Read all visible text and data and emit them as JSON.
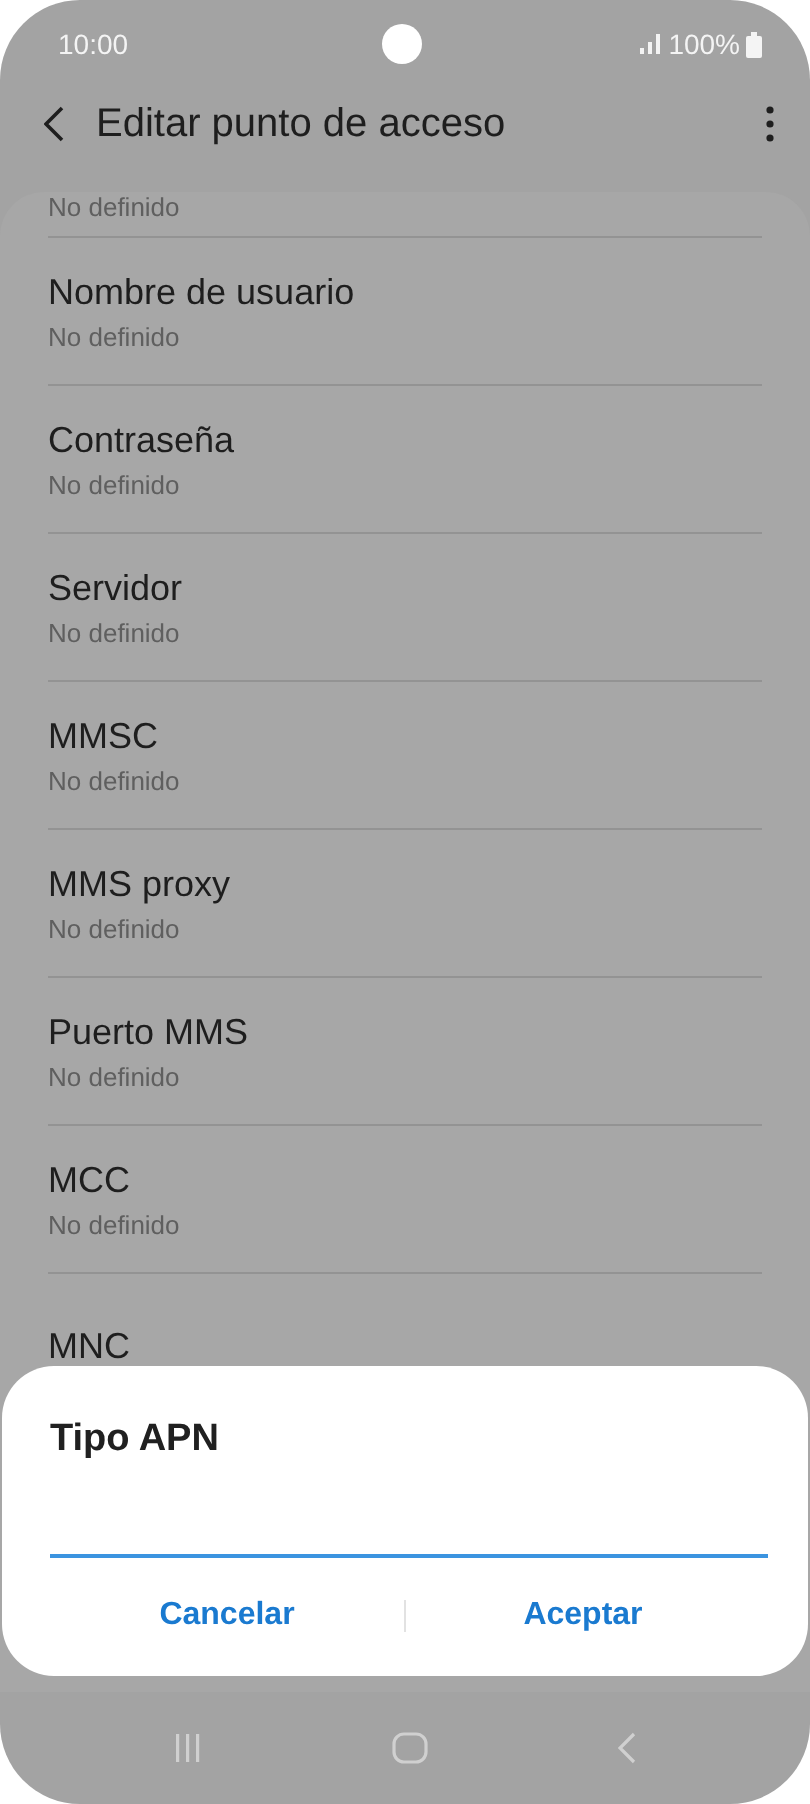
{
  "status_bar": {
    "time": "10:00",
    "battery": "100%"
  },
  "header": {
    "title": "Editar punto de acceso"
  },
  "partial_value": "No definido",
  "settings": [
    {
      "title": "Nombre de usuario",
      "value": "No definido"
    },
    {
      "title": "Contraseña",
      "value": "No definido"
    },
    {
      "title": "Servidor",
      "value": "No definido"
    },
    {
      "title": "MMSC",
      "value": "No definido"
    },
    {
      "title": "MMS proxy",
      "value": "No definido"
    },
    {
      "title": "Puerto MMS",
      "value": "No definido"
    },
    {
      "title": "MCC",
      "value": "No definido"
    },
    {
      "title": "MNC"
    }
  ],
  "dialog": {
    "title": "Tipo APN",
    "buttons": [
      "Cancelar",
      "Aceptar"
    ]
  }
}
